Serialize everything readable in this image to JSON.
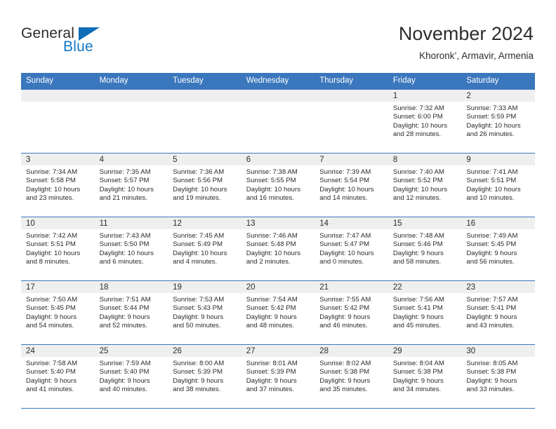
{
  "brand": {
    "name_part1": "General",
    "name_part2": "Blue"
  },
  "header": {
    "title": "November 2024",
    "subtitle": "Khoronk’, Armavir, Armenia"
  },
  "theme": {
    "header_blue": "#3b77bd",
    "daynum_band": "#efefef",
    "brand_blue": "#1277c4",
    "text": "#2d2d2d"
  },
  "weekday_headers": [
    "Sunday",
    "Monday",
    "Tuesday",
    "Wednesday",
    "Thursday",
    "Friday",
    "Saturday"
  ],
  "labels": {
    "sunrise_prefix": "Sunrise:",
    "sunset_prefix": "Sunset:",
    "daylight_prefix": "Daylight:"
  },
  "weeks": [
    [
      {
        "day": "",
        "empty": true
      },
      {
        "day": "",
        "empty": true
      },
      {
        "day": "",
        "empty": true
      },
      {
        "day": "",
        "empty": true
      },
      {
        "day": "",
        "empty": true
      },
      {
        "day": "1",
        "sunrise": "Sunrise: 7:32 AM",
        "sunset": "Sunset: 6:00 PM",
        "daylight_l1": "Daylight: 10 hours",
        "daylight_l2": "and 28 minutes."
      },
      {
        "day": "2",
        "sunrise": "Sunrise: 7:33 AM",
        "sunset": "Sunset: 5:59 PM",
        "daylight_l1": "Daylight: 10 hours",
        "daylight_l2": "and 26 minutes."
      }
    ],
    [
      {
        "day": "3",
        "sunrise": "Sunrise: 7:34 AM",
        "sunset": "Sunset: 5:58 PM",
        "daylight_l1": "Daylight: 10 hours",
        "daylight_l2": "and 23 minutes."
      },
      {
        "day": "4",
        "sunrise": "Sunrise: 7:35 AM",
        "sunset": "Sunset: 5:57 PM",
        "daylight_l1": "Daylight: 10 hours",
        "daylight_l2": "and 21 minutes."
      },
      {
        "day": "5",
        "sunrise": "Sunrise: 7:36 AM",
        "sunset": "Sunset: 5:56 PM",
        "daylight_l1": "Daylight: 10 hours",
        "daylight_l2": "and 19 minutes."
      },
      {
        "day": "6",
        "sunrise": "Sunrise: 7:38 AM",
        "sunset": "Sunset: 5:55 PM",
        "daylight_l1": "Daylight: 10 hours",
        "daylight_l2": "and 16 minutes."
      },
      {
        "day": "7",
        "sunrise": "Sunrise: 7:39 AM",
        "sunset": "Sunset: 5:54 PM",
        "daylight_l1": "Daylight: 10 hours",
        "daylight_l2": "and 14 minutes."
      },
      {
        "day": "8",
        "sunrise": "Sunrise: 7:40 AM",
        "sunset": "Sunset: 5:52 PM",
        "daylight_l1": "Daylight: 10 hours",
        "daylight_l2": "and 12 minutes."
      },
      {
        "day": "9",
        "sunrise": "Sunrise: 7:41 AM",
        "sunset": "Sunset: 5:51 PM",
        "daylight_l1": "Daylight: 10 hours",
        "daylight_l2": "and 10 minutes."
      }
    ],
    [
      {
        "day": "10",
        "sunrise": "Sunrise: 7:42 AM",
        "sunset": "Sunset: 5:51 PM",
        "daylight_l1": "Daylight: 10 hours",
        "daylight_l2": "and 8 minutes."
      },
      {
        "day": "11",
        "sunrise": "Sunrise: 7:43 AM",
        "sunset": "Sunset: 5:50 PM",
        "daylight_l1": "Daylight: 10 hours",
        "daylight_l2": "and 6 minutes."
      },
      {
        "day": "12",
        "sunrise": "Sunrise: 7:45 AM",
        "sunset": "Sunset: 5:49 PM",
        "daylight_l1": "Daylight: 10 hours",
        "daylight_l2": "and 4 minutes."
      },
      {
        "day": "13",
        "sunrise": "Sunrise: 7:46 AM",
        "sunset": "Sunset: 5:48 PM",
        "daylight_l1": "Daylight: 10 hours",
        "daylight_l2": "and 2 minutes."
      },
      {
        "day": "14",
        "sunrise": "Sunrise: 7:47 AM",
        "sunset": "Sunset: 5:47 PM",
        "daylight_l1": "Daylight: 10 hours",
        "daylight_l2": "and 0 minutes."
      },
      {
        "day": "15",
        "sunrise": "Sunrise: 7:48 AM",
        "sunset": "Sunset: 5:46 PM",
        "daylight_l1": "Daylight: 9 hours",
        "daylight_l2": "and 58 minutes."
      },
      {
        "day": "16",
        "sunrise": "Sunrise: 7:49 AM",
        "sunset": "Sunset: 5:45 PM",
        "daylight_l1": "Daylight: 9 hours",
        "daylight_l2": "and 56 minutes."
      }
    ],
    [
      {
        "day": "17",
        "sunrise": "Sunrise: 7:50 AM",
        "sunset": "Sunset: 5:45 PM",
        "daylight_l1": "Daylight: 9 hours",
        "daylight_l2": "and 54 minutes."
      },
      {
        "day": "18",
        "sunrise": "Sunrise: 7:51 AM",
        "sunset": "Sunset: 5:44 PM",
        "daylight_l1": "Daylight: 9 hours",
        "daylight_l2": "and 52 minutes."
      },
      {
        "day": "19",
        "sunrise": "Sunrise: 7:53 AM",
        "sunset": "Sunset: 5:43 PM",
        "daylight_l1": "Daylight: 9 hours",
        "daylight_l2": "and 50 minutes."
      },
      {
        "day": "20",
        "sunrise": "Sunrise: 7:54 AM",
        "sunset": "Sunset: 5:42 PM",
        "daylight_l1": "Daylight: 9 hours",
        "daylight_l2": "and 48 minutes."
      },
      {
        "day": "21",
        "sunrise": "Sunrise: 7:55 AM",
        "sunset": "Sunset: 5:42 PM",
        "daylight_l1": "Daylight: 9 hours",
        "daylight_l2": "and 46 minutes."
      },
      {
        "day": "22",
        "sunrise": "Sunrise: 7:56 AM",
        "sunset": "Sunset: 5:41 PM",
        "daylight_l1": "Daylight: 9 hours",
        "daylight_l2": "and 45 minutes."
      },
      {
        "day": "23",
        "sunrise": "Sunrise: 7:57 AM",
        "sunset": "Sunset: 5:41 PM",
        "daylight_l1": "Daylight: 9 hours",
        "daylight_l2": "and 43 minutes."
      }
    ],
    [
      {
        "day": "24",
        "sunrise": "Sunrise: 7:58 AM",
        "sunset": "Sunset: 5:40 PM",
        "daylight_l1": "Daylight: 9 hours",
        "daylight_l2": "and 41 minutes."
      },
      {
        "day": "25",
        "sunrise": "Sunrise: 7:59 AM",
        "sunset": "Sunset: 5:40 PM",
        "daylight_l1": "Daylight: 9 hours",
        "daylight_l2": "and 40 minutes."
      },
      {
        "day": "26",
        "sunrise": "Sunrise: 8:00 AM",
        "sunset": "Sunset: 5:39 PM",
        "daylight_l1": "Daylight: 9 hours",
        "daylight_l2": "and 38 minutes."
      },
      {
        "day": "27",
        "sunrise": "Sunrise: 8:01 AM",
        "sunset": "Sunset: 5:39 PM",
        "daylight_l1": "Daylight: 9 hours",
        "daylight_l2": "and 37 minutes."
      },
      {
        "day": "28",
        "sunrise": "Sunrise: 8:02 AM",
        "sunset": "Sunset: 5:38 PM",
        "daylight_l1": "Daylight: 9 hours",
        "daylight_l2": "and 35 minutes."
      },
      {
        "day": "29",
        "sunrise": "Sunrise: 8:04 AM",
        "sunset": "Sunset: 5:38 PM",
        "daylight_l1": "Daylight: 9 hours",
        "daylight_l2": "and 34 minutes."
      },
      {
        "day": "30",
        "sunrise": "Sunrise: 8:05 AM",
        "sunset": "Sunset: 5:38 PM",
        "daylight_l1": "Daylight: 9 hours",
        "daylight_l2": "and 33 minutes."
      }
    ]
  ]
}
